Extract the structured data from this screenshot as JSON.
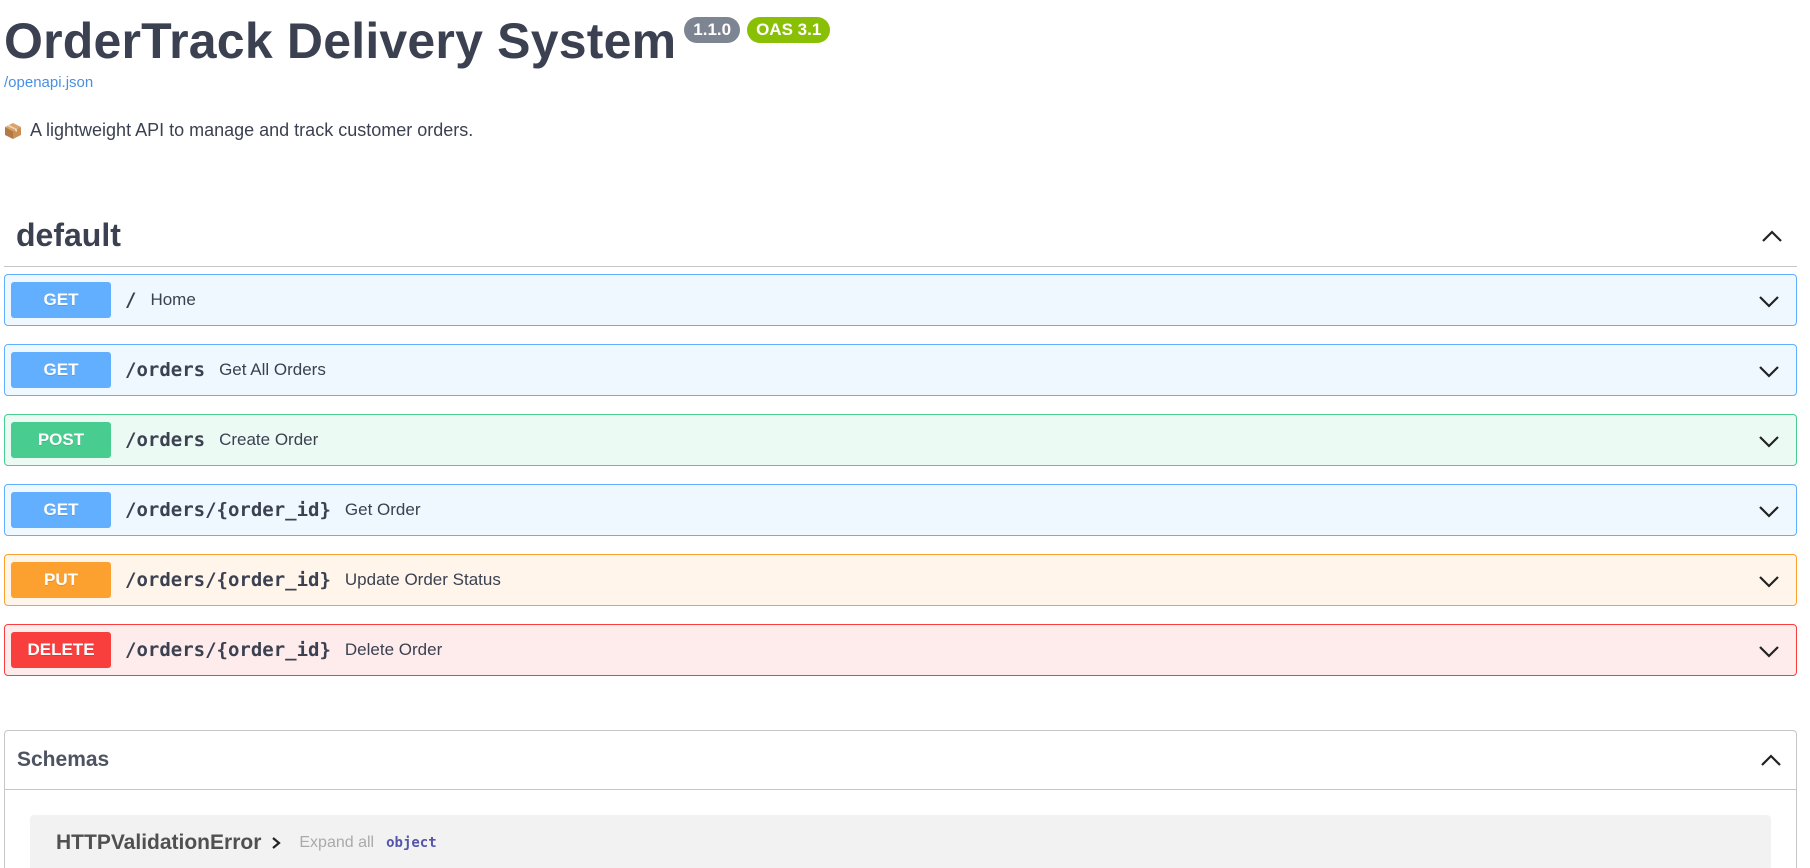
{
  "info": {
    "title": "OrderTrack Delivery System",
    "version_badge": "1.1.0",
    "oas_badge": "OAS 3.1",
    "spec_link": "/openapi.json",
    "description_icon": "package-icon",
    "description": "A lightweight API to manage and track customer orders."
  },
  "tag": {
    "name": "default",
    "toggle_icon": "chevron-up-icon"
  },
  "operations": [
    {
      "method": "GET",
      "path": "/",
      "summary": "Home"
    },
    {
      "method": "GET",
      "path": "/orders",
      "summary": "Get All Orders"
    },
    {
      "method": "POST",
      "path": "/orders",
      "summary": "Create Order"
    },
    {
      "method": "GET",
      "path": "/orders/{order_id}",
      "summary": "Get Order"
    },
    {
      "method": "PUT",
      "path": "/orders/{order_id}",
      "summary": "Update Order Status"
    },
    {
      "method": "DELETE",
      "path": "/orders/{order_id}",
      "summary": "Delete Order"
    }
  ],
  "schemas": {
    "title": "Schemas",
    "models": [
      {
        "name": "HTTPValidationError",
        "expand_label": "Expand all",
        "type": "object"
      }
    ]
  },
  "colors": {
    "get": "#61affe",
    "post": "#49cc90",
    "put": "#fca130",
    "delete": "#f93e3e",
    "link": "#4990e2",
    "oas_badge": "#89bf04",
    "version_badge": "#7d8492"
  }
}
